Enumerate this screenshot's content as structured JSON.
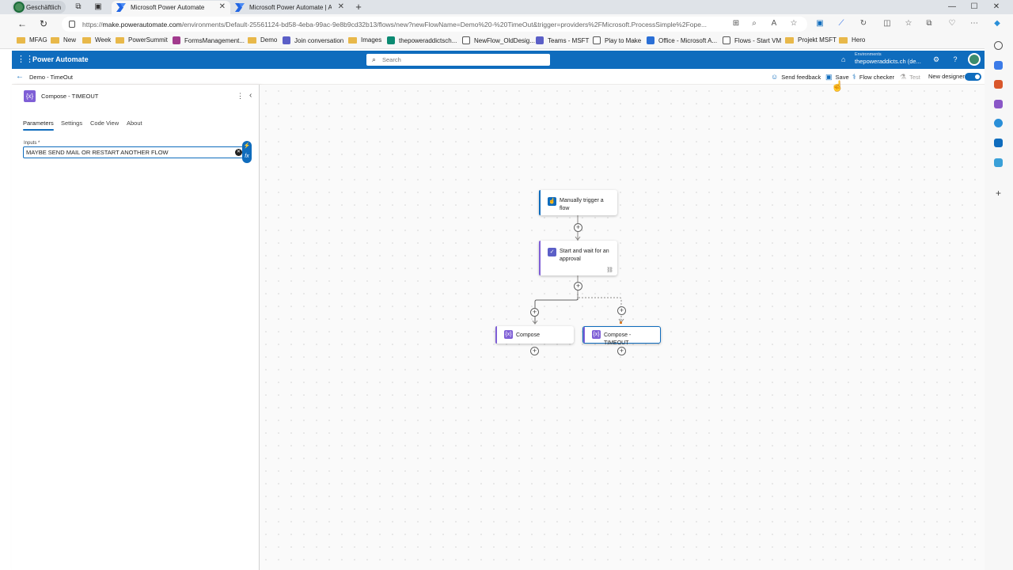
{
  "browser": {
    "profile_label": "Geschäftlich",
    "tabs": [
      {
        "title": "Microsoft Power Automate",
        "active": true
      },
      {
        "title": "Microsoft Power Automate | App",
        "active": false
      }
    ],
    "new_tab": "+",
    "url_domain": "make.powerautomate.com",
    "url_path": "/environments/Default-25561124-bd58-4eba-99ac-9e8b9cd32b13/flows/new?newFlowName=Demo%20-%20TimeOut&trigger=providers%2FMicrosoft.ProcessSimple%2Fope...",
    "url_prefix": "https://",
    "bookmarks": [
      "MFAG",
      "New",
      "Week",
      "PowerSummit",
      "FormsManagement...",
      "Demo",
      "Join conversation",
      "Images",
      "thepoweraddictsch...",
      "NewFlow_OldDesig...",
      "Teams - MSFT",
      "Play to Make",
      "Office - Microsoft A...",
      "Flows - Start VM",
      "Projekt MSFT",
      "Hero"
    ]
  },
  "app": {
    "name": "Power Automate",
    "search_placeholder": "Search",
    "environment_label": "Environments",
    "environment_value": "thepoweraddicts.ch (de..."
  },
  "toolbar": {
    "flow_name": "Demo - TimeOut",
    "send_feedback": "Send feedback",
    "save": "Save",
    "flow_checker": "Flow checker",
    "test": "Test",
    "new_designer": "New designer",
    "new_designer_on": true
  },
  "panel": {
    "title": "Compose - TIMEOUT",
    "tabs": [
      "Parameters",
      "Settings",
      "Code View",
      "About"
    ],
    "active_tab": "Parameters",
    "inputs_label": "Inputs *",
    "inputs_value": "MAYBE SEND MAIL OR RESTART ANOTHER FLOW"
  },
  "flow": {
    "trigger": "Manually trigger a flow",
    "approval": "Start and wait for an approval",
    "branch_left": "Compose",
    "branch_right": "Compose - TIMEOUT"
  },
  "colors": {
    "brand": "#0f6cbd",
    "compose_purple": "#7f5fd6",
    "trigger_blue": "#0f6cbd"
  }
}
